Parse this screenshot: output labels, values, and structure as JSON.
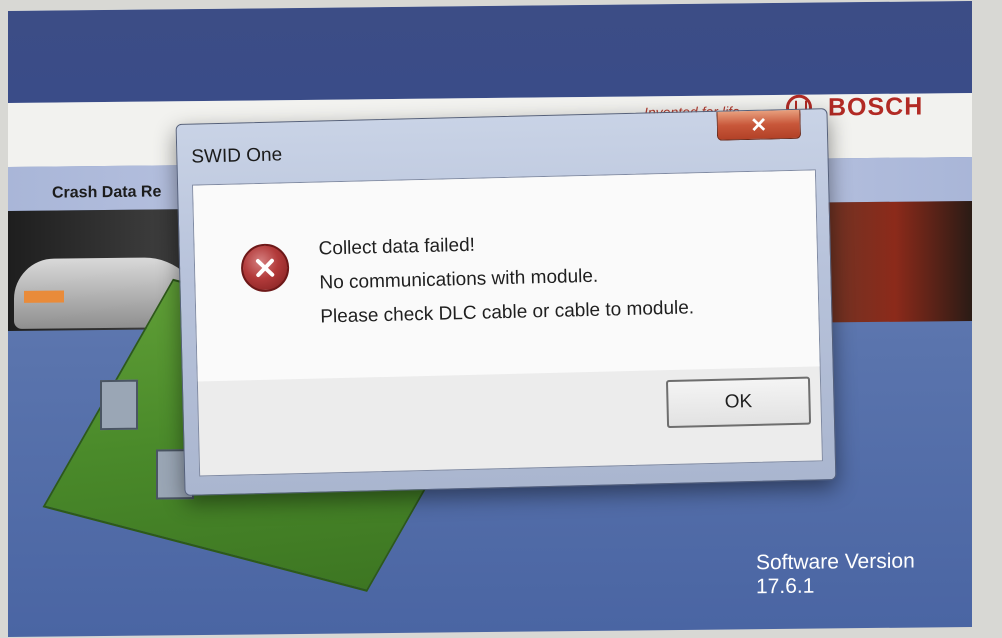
{
  "background_app": {
    "slogan": "Invented for life",
    "brand": "BOSCH",
    "app_title": "Crash Data Re",
    "software_version": "Software Version 17.6.1"
  },
  "dialog": {
    "title": "SWID One",
    "close_label": "✕",
    "messages": [
      "Collect data failed!",
      "No communications with module.",
      "Please check DLC cable or cable to module."
    ],
    "ok_label": "OK",
    "icon": "error-icon"
  },
  "colors": {
    "brand_red": "#b22a24",
    "close_button": "#c8573a",
    "backdrop_blue": "#5a74ad"
  }
}
